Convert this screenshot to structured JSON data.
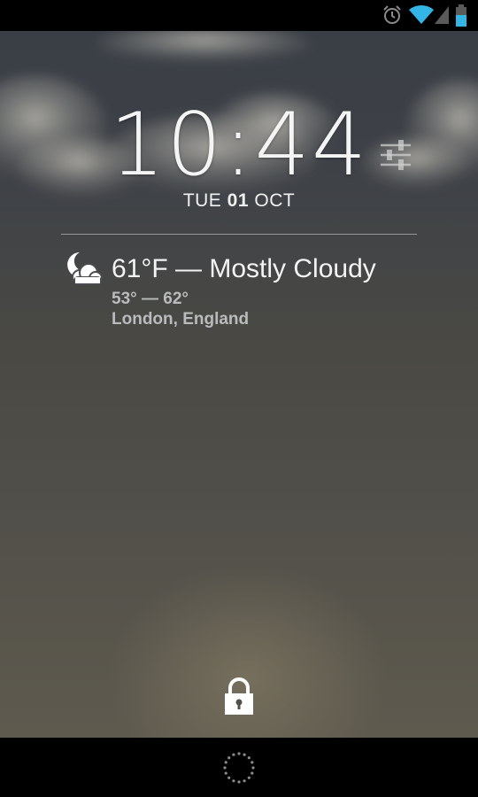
{
  "status_bar": {
    "icons": [
      "alarm-icon",
      "wifi-icon",
      "signal-icon",
      "battery-icon"
    ],
    "wifi_color": "#33b5e5",
    "battery_color": "#33b5e5"
  },
  "clock": {
    "hours": "10",
    "separator": ":",
    "minutes": "44"
  },
  "date": {
    "weekday": "TUE",
    "day": "01",
    "month": "OCT"
  },
  "weather": {
    "icon": "partly-cloudy-night-icon",
    "summary": "61°F — Mostly Cloudy",
    "range": "53° — 62°",
    "location": "London, England"
  },
  "lock": {
    "icon": "padlock-icon"
  },
  "nav": {
    "icon": "unlock-ring-icon"
  }
}
